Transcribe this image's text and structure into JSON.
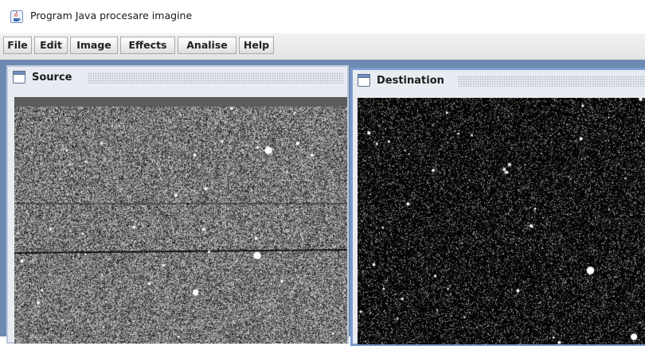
{
  "window": {
    "title": "Program Java procesare imagine",
    "icon": "java-coffee-icon"
  },
  "menu": [
    {
      "label": "File"
    },
    {
      "label": "Edit"
    },
    {
      "label": "Image"
    },
    {
      "label": "Effects"
    },
    {
      "label": "Analise"
    },
    {
      "label": "Help"
    }
  ],
  "frames": {
    "source": {
      "title": "Source",
      "icon": "window-icon"
    },
    "destination": {
      "title": "Destination",
      "icon": "window-icon"
    }
  },
  "colors": {
    "desktop": "#6e8bb1",
    "active_frame_border": "#7c9ccf",
    "inactive_frame_border": "#bcc8da"
  }
}
